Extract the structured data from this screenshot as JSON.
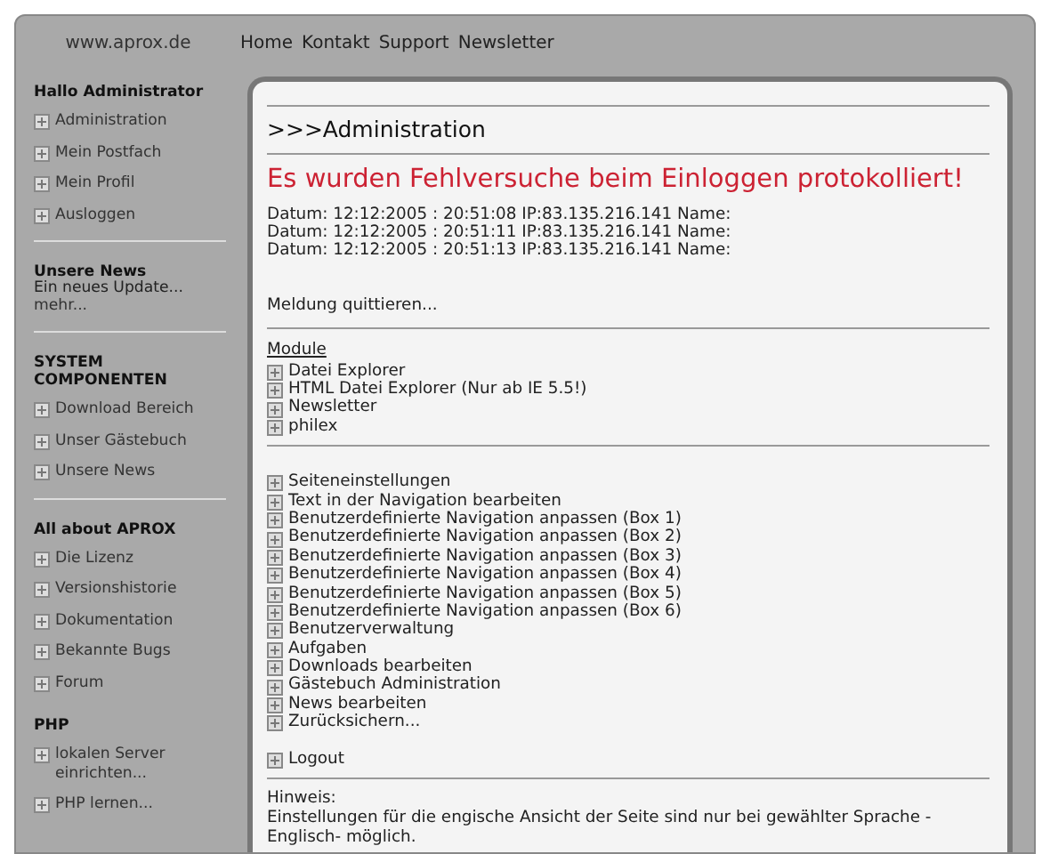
{
  "header": {
    "site": "www.aprox.de",
    "nav": [
      "Home",
      "Kontakt",
      "Support",
      "Newsletter"
    ]
  },
  "sidebar": [
    {
      "kind": "menu",
      "title": "Hallo Administrator",
      "items": [
        "Administration",
        "Mein Postfach",
        "Mein Profil",
        "Ausloggen"
      ],
      "divider": true
    },
    {
      "kind": "news",
      "title": "Unsere News",
      "text": "Ein neues Update...",
      "link": "mehr...",
      "divider": true
    },
    {
      "kind": "menu",
      "title": "SYSTEM COMPONENTEN",
      "items": [
        "Download Bereich",
        "Unser Gästebuch",
        "Unsere News"
      ],
      "divider": true
    },
    {
      "kind": "menu",
      "title": "All about APROX",
      "items": [
        "Die Lizenz",
        "Versionshistorie",
        "Dokumentation",
        "Bekannte Bugs",
        "Forum"
      ],
      "divider": false
    },
    {
      "kind": "menu",
      "title": "PHP",
      "items": [
        "lokalen Server einrichten...",
        "PHP lernen..."
      ],
      "divider": false
    }
  ],
  "content": {
    "heading": ">>>Administration",
    "error": "Es wurden Fehlversuche beim Einloggen protokolliert!",
    "log": [
      "Datum: 12:12:2005 : 20:51:08 IP:83.135.216.141 Name:",
      "Datum: 12:12:2005 : 20:51:11 IP:83.135.216.141 Name:",
      "Datum: 12:12:2005 : 20:51:13 IP:83.135.216.141 Name:"
    ],
    "acknowledge": "Meldung quittieren...",
    "modules_title": "Module",
    "modules": [
      "Datei Explorer",
      "HTML Datei Explorer (Nur ab IE 5.5!)",
      "Newsletter",
      "philex"
    ],
    "admin": [
      "Seiteneinstellungen",
      "Text in der Navigation bearbeiten",
      "Benutzerdefinierte Navigation anpassen (Box 1)",
      "Benutzerdefinierte Navigation anpassen (Box 2)",
      "Benutzerdefinierte Navigation anpassen (Box 3)",
      "Benutzerdefinierte Navigation anpassen (Box 4)",
      "Benutzerdefinierte Navigation anpassen (Box 5)",
      "Benutzerdefinierte Navigation anpassen (Box 6)",
      "Benutzerverwaltung",
      "Aufgaben",
      "Downloads bearbeiten",
      "Gästebuch Administration",
      "News bearbeiten",
      "Zurücksichern..."
    ],
    "logout": "Logout",
    "hint_label": "Hinweis:",
    "hint": "Einstellungen für die engische Ansicht der Seite sind nur bei gewählter Sprache -Englisch- möglich."
  }
}
